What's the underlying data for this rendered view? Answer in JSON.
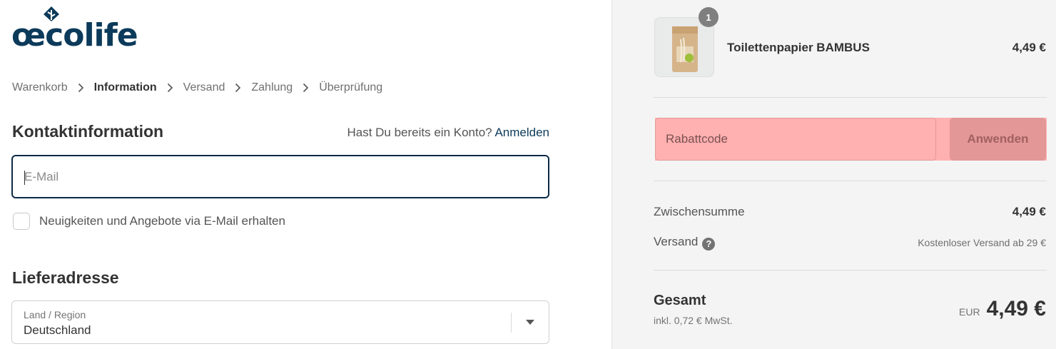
{
  "brand": {
    "logo_text": "œcolife"
  },
  "breadcrumb": [
    {
      "label": "Warenkorb"
    },
    {
      "label": "Information"
    },
    {
      "label": "Versand"
    },
    {
      "label": "Zahlung"
    },
    {
      "label": "Überprüfung"
    }
  ],
  "contact": {
    "title": "Kontaktinformation",
    "account_prompt": "Hast Du bereits ein Konto?",
    "login_link": "Anmelden",
    "email_placeholder": "E-Mail",
    "email_value": "",
    "newsletter_label": "Neuigkeiten und Angebote via E-Mail erhalten",
    "newsletter_checked": false
  },
  "shipping_address": {
    "title": "Lieferadresse",
    "country_label": "Land / Region",
    "country_value": "Deutschland"
  },
  "order_summary": {
    "product": {
      "name": "Toilettenpapier BAMBUS",
      "price": "4,49 €",
      "quantity": "1"
    },
    "discount": {
      "placeholder": "Rabattcode",
      "apply_label": "Anwenden"
    },
    "subtotal_label": "Zwischensumme",
    "subtotal_value": "4,49 €",
    "shipping_label": "Versand",
    "shipping_value": "Kostenloser Versand ab 29 €",
    "total_label": "Gesamt",
    "tax_note": "inkl. 0,72 € MwSt.",
    "currency": "EUR",
    "total_value": "4,49 €"
  },
  "colors": {
    "brand": "#0c3a5a",
    "highlight": "#ffb0b0",
    "panel": "#f4f4f4"
  },
  "icons": {
    "chevron": "chevron-right-icon",
    "help": "question-circle-icon",
    "select_arrow": "caret-down-icon"
  }
}
